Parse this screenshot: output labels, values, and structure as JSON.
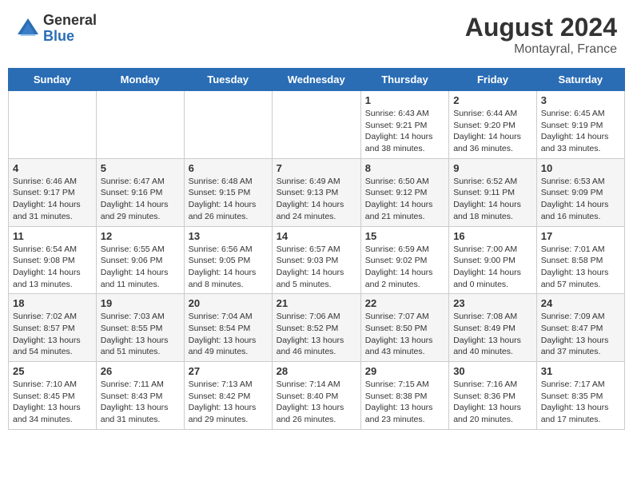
{
  "header": {
    "logo_general": "General",
    "logo_blue": "Blue",
    "month_year": "August 2024",
    "location": "Montayral, France"
  },
  "weekdays": [
    "Sunday",
    "Monday",
    "Tuesday",
    "Wednesday",
    "Thursday",
    "Friday",
    "Saturday"
  ],
  "weeks": [
    [
      {
        "day": "",
        "info": ""
      },
      {
        "day": "",
        "info": ""
      },
      {
        "day": "",
        "info": ""
      },
      {
        "day": "",
        "info": ""
      },
      {
        "day": "1",
        "info": "Sunrise: 6:43 AM\nSunset: 9:21 PM\nDaylight: 14 hours\nand 38 minutes."
      },
      {
        "day": "2",
        "info": "Sunrise: 6:44 AM\nSunset: 9:20 PM\nDaylight: 14 hours\nand 36 minutes."
      },
      {
        "day": "3",
        "info": "Sunrise: 6:45 AM\nSunset: 9:19 PM\nDaylight: 14 hours\nand 33 minutes."
      }
    ],
    [
      {
        "day": "4",
        "info": "Sunrise: 6:46 AM\nSunset: 9:17 PM\nDaylight: 14 hours\nand 31 minutes."
      },
      {
        "day": "5",
        "info": "Sunrise: 6:47 AM\nSunset: 9:16 PM\nDaylight: 14 hours\nand 29 minutes."
      },
      {
        "day": "6",
        "info": "Sunrise: 6:48 AM\nSunset: 9:15 PM\nDaylight: 14 hours\nand 26 minutes."
      },
      {
        "day": "7",
        "info": "Sunrise: 6:49 AM\nSunset: 9:13 PM\nDaylight: 14 hours\nand 24 minutes."
      },
      {
        "day": "8",
        "info": "Sunrise: 6:50 AM\nSunset: 9:12 PM\nDaylight: 14 hours\nand 21 minutes."
      },
      {
        "day": "9",
        "info": "Sunrise: 6:52 AM\nSunset: 9:11 PM\nDaylight: 14 hours\nand 18 minutes."
      },
      {
        "day": "10",
        "info": "Sunrise: 6:53 AM\nSunset: 9:09 PM\nDaylight: 14 hours\nand 16 minutes."
      }
    ],
    [
      {
        "day": "11",
        "info": "Sunrise: 6:54 AM\nSunset: 9:08 PM\nDaylight: 14 hours\nand 13 minutes."
      },
      {
        "day": "12",
        "info": "Sunrise: 6:55 AM\nSunset: 9:06 PM\nDaylight: 14 hours\nand 11 minutes."
      },
      {
        "day": "13",
        "info": "Sunrise: 6:56 AM\nSunset: 9:05 PM\nDaylight: 14 hours\nand 8 minutes."
      },
      {
        "day": "14",
        "info": "Sunrise: 6:57 AM\nSunset: 9:03 PM\nDaylight: 14 hours\nand 5 minutes."
      },
      {
        "day": "15",
        "info": "Sunrise: 6:59 AM\nSunset: 9:02 PM\nDaylight: 14 hours\nand 2 minutes."
      },
      {
        "day": "16",
        "info": "Sunrise: 7:00 AM\nSunset: 9:00 PM\nDaylight: 14 hours\nand 0 minutes."
      },
      {
        "day": "17",
        "info": "Sunrise: 7:01 AM\nSunset: 8:58 PM\nDaylight: 13 hours\nand 57 minutes."
      }
    ],
    [
      {
        "day": "18",
        "info": "Sunrise: 7:02 AM\nSunset: 8:57 PM\nDaylight: 13 hours\nand 54 minutes."
      },
      {
        "day": "19",
        "info": "Sunrise: 7:03 AM\nSunset: 8:55 PM\nDaylight: 13 hours\nand 51 minutes."
      },
      {
        "day": "20",
        "info": "Sunrise: 7:04 AM\nSunset: 8:54 PM\nDaylight: 13 hours\nand 49 minutes."
      },
      {
        "day": "21",
        "info": "Sunrise: 7:06 AM\nSunset: 8:52 PM\nDaylight: 13 hours\nand 46 minutes."
      },
      {
        "day": "22",
        "info": "Sunrise: 7:07 AM\nSunset: 8:50 PM\nDaylight: 13 hours\nand 43 minutes."
      },
      {
        "day": "23",
        "info": "Sunrise: 7:08 AM\nSunset: 8:49 PM\nDaylight: 13 hours\nand 40 minutes."
      },
      {
        "day": "24",
        "info": "Sunrise: 7:09 AM\nSunset: 8:47 PM\nDaylight: 13 hours\nand 37 minutes."
      }
    ],
    [
      {
        "day": "25",
        "info": "Sunrise: 7:10 AM\nSunset: 8:45 PM\nDaylight: 13 hours\nand 34 minutes."
      },
      {
        "day": "26",
        "info": "Sunrise: 7:11 AM\nSunset: 8:43 PM\nDaylight: 13 hours\nand 31 minutes."
      },
      {
        "day": "27",
        "info": "Sunrise: 7:13 AM\nSunset: 8:42 PM\nDaylight: 13 hours\nand 29 minutes."
      },
      {
        "day": "28",
        "info": "Sunrise: 7:14 AM\nSunset: 8:40 PM\nDaylight: 13 hours\nand 26 minutes."
      },
      {
        "day": "29",
        "info": "Sunrise: 7:15 AM\nSunset: 8:38 PM\nDaylight: 13 hours\nand 23 minutes."
      },
      {
        "day": "30",
        "info": "Sunrise: 7:16 AM\nSunset: 8:36 PM\nDaylight: 13 hours\nand 20 minutes."
      },
      {
        "day": "31",
        "info": "Sunrise: 7:17 AM\nSunset: 8:35 PM\nDaylight: 13 hours\nand 17 minutes."
      }
    ]
  ]
}
